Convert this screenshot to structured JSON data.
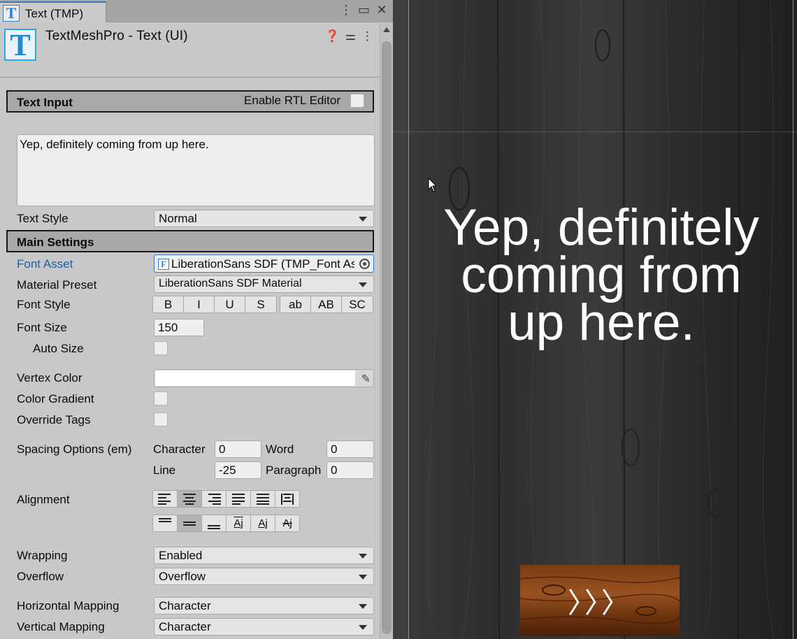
{
  "window": {
    "tab_title": "Text (TMP)",
    "tab_icon": "T",
    "tab_tools": [
      "more-icon",
      "maximize-icon",
      "close-icon"
    ]
  },
  "component": {
    "icon": "T",
    "title": "TextMeshPro - Text (UI)",
    "tools": [
      "help-icon",
      "preset-icon",
      "more-icon"
    ]
  },
  "text_input": {
    "header": "Text Input",
    "rtl_label": "Enable RTL Editor",
    "rtl_checked": false,
    "value": "Yep, definitely coming from up here.",
    "text_style_label": "Text Style",
    "text_style_value": "Normal"
  },
  "main_settings": {
    "header": "Main Settings",
    "font_asset_label": "Font Asset",
    "font_asset_value": "LiberationSans SDF (TMP_Font Asset)",
    "material_preset_label": "Material Preset",
    "material_preset_value": "LiberationSans SDF Material",
    "font_style_label": "Font Style",
    "font_style_buttons": [
      "B",
      "I",
      "U",
      "S"
    ],
    "font_case_buttons": [
      "ab",
      "AB",
      "SC"
    ],
    "font_size_label": "Font Size",
    "font_size_value": "150",
    "auto_size_label": "Auto Size",
    "vertex_color_label": "Vertex Color",
    "vertex_color": "#ffffff",
    "color_gradient_label": "Color Gradient",
    "override_tags_label": "Override Tags",
    "spacing_label": "Spacing Options (em)",
    "character_label": "Character",
    "character_value": "0",
    "word_label": "Word",
    "word_value": "0",
    "line_label": "Line",
    "line_value": "-25",
    "paragraph_label": "Paragraph",
    "paragraph_value": "0",
    "alignment_label": "Alignment",
    "h_align_selected": 1,
    "v_align_selected": 1,
    "v_align_text_icons": [
      "Aj",
      "Aj",
      "Aj"
    ],
    "wrapping_label": "Wrapping",
    "wrapping_value": "Enabled",
    "overflow_label": "Overflow",
    "overflow_value": "Overflow",
    "h_mapping_label": "Horizontal Mapping",
    "h_mapping_value": "Character",
    "v_mapping_label": "Vertical Mapping",
    "v_mapping_value": "Character"
  },
  "scene": {
    "display_text": "Yep, definitely\ncoming from\nup here.",
    "next_button_arrows": "〉〉〉",
    "text_color": "#ffffff",
    "background_color": "#2c2c2c"
  }
}
